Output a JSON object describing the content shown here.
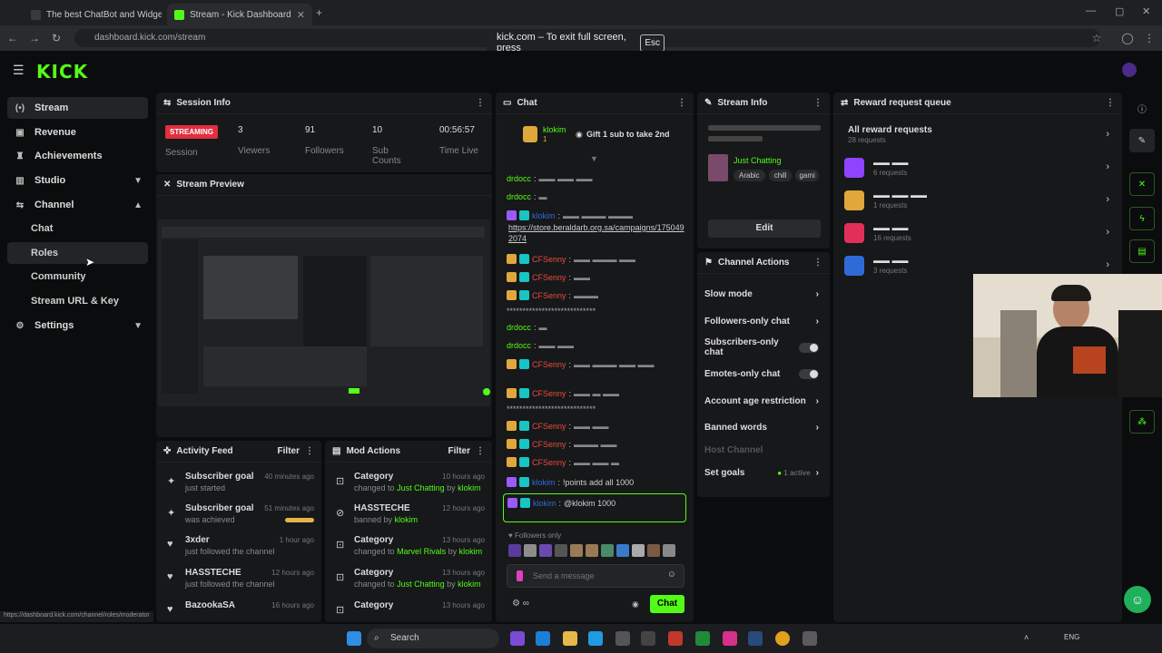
{
  "browser": {
    "tabs": [
      {
        "title": "The best ChatBot and Widgets"
      },
      {
        "title": "Stream - Kick Dashboard"
      }
    ],
    "url": "dashboard.kick.com/stream",
    "fullscreen_notice": "kick.com – To exit full screen, press",
    "esc_key": "Esc",
    "status_url": "https://dashboard.kick.com/channel/roles/moderator"
  },
  "app": {
    "logo": "KICK",
    "accent": "#53fc18"
  },
  "sidebar": {
    "stream": "Stream",
    "revenue": "Revenue",
    "achievements": "Achievements",
    "studio": "Studio",
    "channel": "Channel",
    "chat": "Chat",
    "roles": "Roles",
    "community": "Community",
    "stream_url_key": "Stream URL & Key",
    "settings": "Settings"
  },
  "session": {
    "title": "Session Info",
    "status_badge": "STREAMING",
    "session_label": "Session",
    "viewers_value": "3",
    "viewers_label": "Viewers",
    "followers_value": "91",
    "followers_label": "Followers",
    "subs_value": "10",
    "subs_label": "Sub Counts",
    "time_value": "00:56:57",
    "time_label": "Time Live"
  },
  "preview": {
    "title": "Stream Preview"
  },
  "activity": {
    "title": "Activity Feed",
    "filter": "Filter",
    "items": [
      {
        "title": "Subscriber goal",
        "sub": "just started",
        "time": "40 minutes ago"
      },
      {
        "title": "Subscriber goal",
        "sub": "was achieved",
        "time": "51 minutes ago"
      },
      {
        "title": "3xder",
        "sub": "just followed the channel",
        "time": "1 hour ago"
      },
      {
        "title": "HASSTECHE",
        "sub": "just followed the channel",
        "time": "12 hours ago"
      },
      {
        "title": "BazookaSA",
        "sub": "",
        "time": "16 hours ago"
      }
    ]
  },
  "modactions": {
    "title": "Mod Actions",
    "filter": "Filter",
    "items": [
      {
        "title": "Category",
        "pre": "changed to",
        "hl": "Just Chatting",
        "by": "by",
        "user": "klokim",
        "time": "10 hours ago"
      },
      {
        "title": "HASSTECHE",
        "pre": "banned by",
        "hl": "",
        "by": "",
        "user": "klokim",
        "time": "12 hours ago"
      },
      {
        "title": "Category",
        "pre": "changed to",
        "hl": "Marvel Rivals",
        "by": "by",
        "user": "klokim",
        "time": "13 hours ago"
      },
      {
        "title": "Category",
        "pre": "changed to",
        "hl": "Just Chatting",
        "by": "by",
        "user": "klokim",
        "time": "13 hours ago"
      },
      {
        "title": "Category",
        "pre": "",
        "hl": "",
        "by": "",
        "user": "",
        "time": "13 hours ago"
      }
    ]
  },
  "chat": {
    "title": "Chat",
    "pinned_user": "klokim",
    "pinned_count": "1",
    "pinned_text": "Gift 1 sub to take 2nd",
    "link": "https://store.beraldarb.org.sa/campaigns/1750492074",
    "line_points": "!points add all 1000",
    "mention": "@klokim 1000",
    "followers_only": "Followers only",
    "placeholder": "Send a message",
    "send": "Chat",
    "users": [
      "drdocc",
      "klokim",
      "CFSenny"
    ]
  },
  "streaminfo": {
    "title": "Stream Info",
    "category": "Just Chatting",
    "tags": [
      "Arabic",
      "chill",
      "gami"
    ],
    "edit": "Edit"
  },
  "actions": {
    "title": "Channel Actions",
    "slow": "Slow mode",
    "followers": "Followers-only chat",
    "subs": "Subscribers-only chat",
    "emotes": "Emotes-only chat",
    "age": "Account age restriction",
    "banned": "Banned words",
    "host": "Host Channel",
    "goals": "Set goals",
    "goals_badge": "1 active"
  },
  "rewards": {
    "title": "Reward request queue",
    "all": "All reward requests",
    "all_count": "28 requests",
    "items": [
      {
        "count": "6 requests",
        "color": "#8e44ff"
      },
      {
        "count": "1 requests",
        "color": "#e0a83a"
      },
      {
        "count": "16 requests",
        "color": "#e0305a"
      },
      {
        "count": "3 requests",
        "color": "#2f6bd8"
      }
    ]
  },
  "taskbar": {
    "search": "Search",
    "lang": "ENG"
  }
}
